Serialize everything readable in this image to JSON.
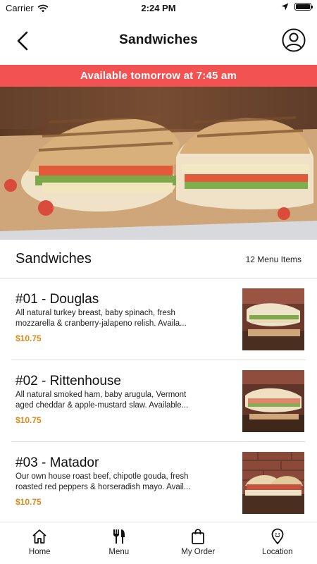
{
  "status_bar": {
    "carrier": "Carrier",
    "time": "2:24 PM"
  },
  "nav": {
    "title": "Sandwiches"
  },
  "banner": {
    "text": "Available tomorrow at 7:45 am"
  },
  "section": {
    "title": "Sandwiches",
    "count": "12 Menu Items"
  },
  "items": [
    {
      "name": "#01 - Douglas",
      "description": "All natural turkey breast, baby spinach, fresh mozzarella & cranberry-jalapeno relish.  Availa...",
      "price": "$10.75"
    },
    {
      "name": "#02 - Rittenhouse",
      "description": "All natural smoked ham, baby arugula, Vermont aged cheddar & apple-mustard slaw.  Available...",
      "price": "$10.75"
    },
    {
      "name": "#03 - Matador",
      "description": "Our own house roast beef, chipotle gouda, fresh roasted red peppers & horseradish mayo.  Avail...",
      "price": "$10.75"
    }
  ],
  "tabs": [
    {
      "label": "Home",
      "icon": "home-icon"
    },
    {
      "label": "Menu",
      "icon": "fork-knife-icon"
    },
    {
      "label": "My Order",
      "icon": "shopping-bag-icon"
    },
    {
      "label": "Location",
      "icon": "location-pin-icon"
    }
  ],
  "colors": {
    "banner": "#f25252",
    "price": "#d98a1c"
  }
}
